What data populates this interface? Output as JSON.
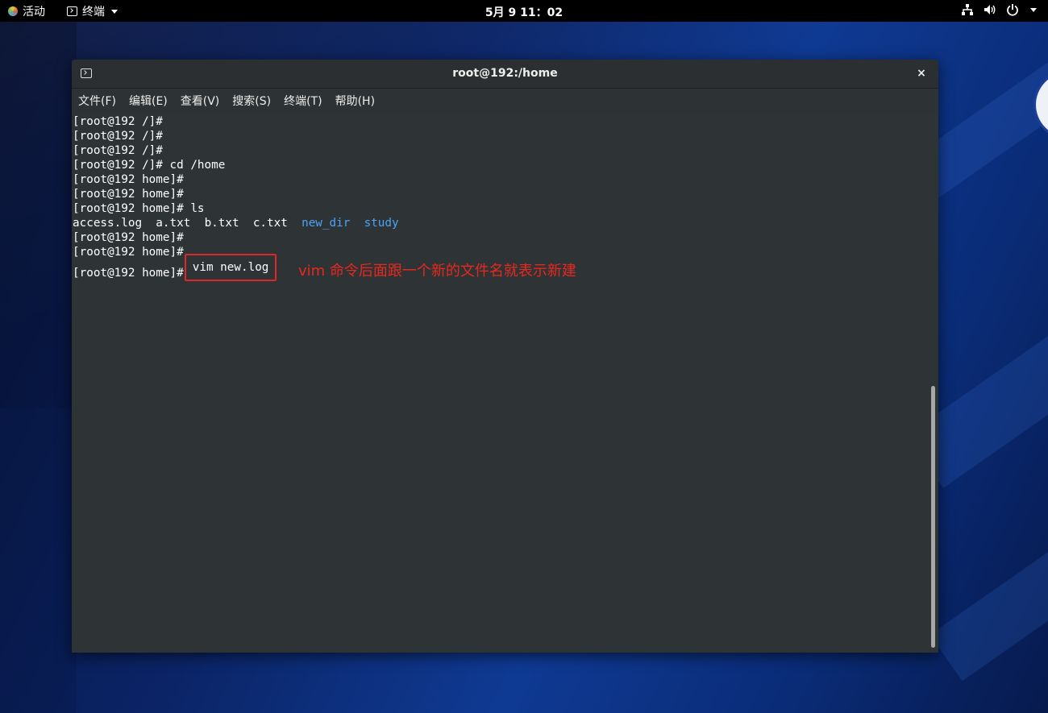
{
  "topbar": {
    "activities_label": "活动",
    "app_label": "终端",
    "clock": "5月 9  11：02",
    "tray_icons": [
      "network-icon",
      "volume-icon",
      "power-icon",
      "chevron-down-icon"
    ]
  },
  "window": {
    "title": "root@192:/home",
    "close_glyph": "×",
    "menu": [
      {
        "label": "文件(F)"
      },
      {
        "label": "编辑(E)"
      },
      {
        "label": "查看(V)"
      },
      {
        "label": "搜索(S)"
      },
      {
        "label": "终端(T)"
      },
      {
        "label": "帮助(H)"
      }
    ]
  },
  "terminal": {
    "lines": [
      "[root@192 /]#",
      "[root@192 /]#",
      "[root@192 /]#",
      "[root@192 /]# cd /home",
      "[root@192 home]#",
      "[root@192 home]#",
      "[root@192 home]# ls"
    ],
    "ls_output": {
      "files": [
        "access.log",
        "a.txt",
        "b.txt",
        "c.txt"
      ],
      "dirs": [
        "new_dir",
        "study"
      ]
    },
    "after_lines": [
      "[root@192 home]#",
      "[root@192 home]#"
    ],
    "last_prompt": "[root@192 home]#",
    "last_command": "vim new.log",
    "annotation": "vim 命令后面跟一个新的文件名就表示新建",
    "colors": {
      "background": "#2e3436",
      "text": "#ffffff",
      "directory": "#4da3f5",
      "annotation": "#e8271f",
      "highlight_box": "#e02626"
    }
  }
}
